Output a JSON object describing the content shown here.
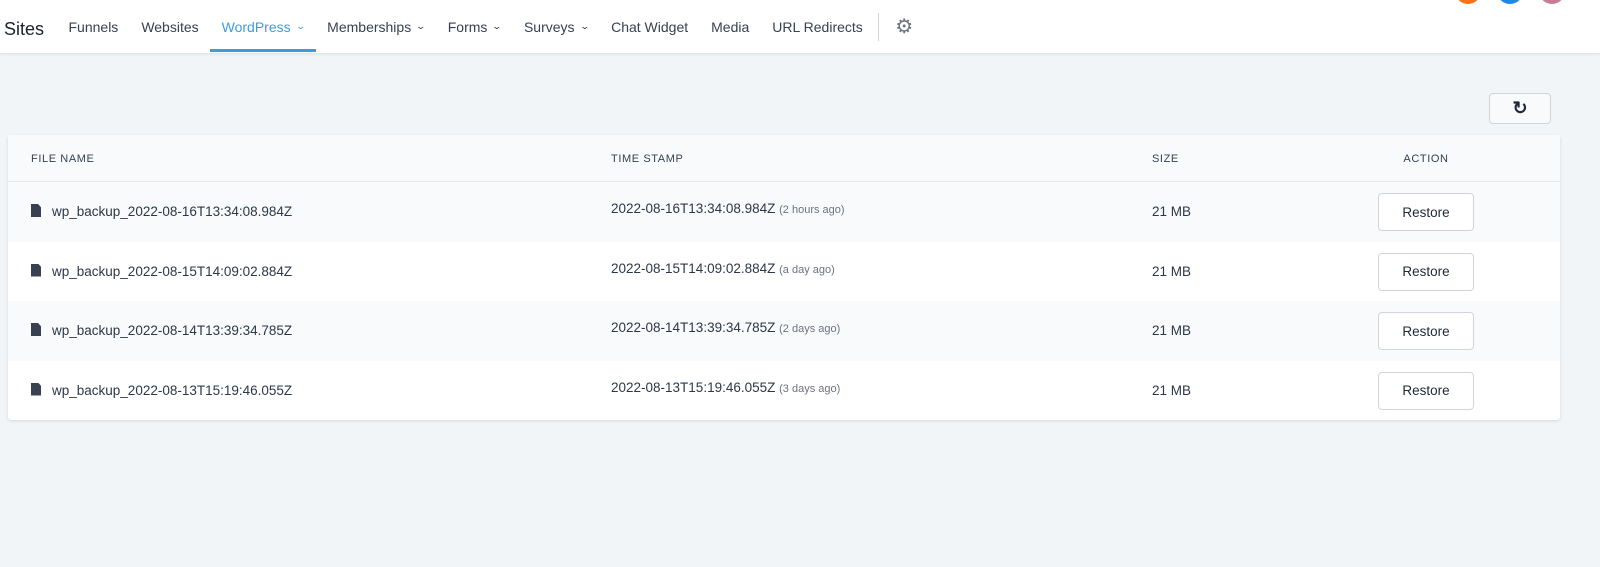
{
  "header": {
    "brand": "Sites",
    "nav": [
      {
        "label": "Funnels",
        "dropdown": false
      },
      {
        "label": "Websites",
        "dropdown": false
      },
      {
        "label": "WordPress",
        "dropdown": true,
        "active": true
      },
      {
        "label": "Memberships",
        "dropdown": true
      },
      {
        "label": "Forms",
        "dropdown": true
      },
      {
        "label": "Surveys",
        "dropdown": true
      },
      {
        "label": "Chat Widget",
        "dropdown": false
      },
      {
        "label": "Media",
        "dropdown": false
      },
      {
        "label": "URL Redirects",
        "dropdown": false
      }
    ],
    "accent": "#3b9ddd"
  },
  "table": {
    "columns": [
      "FILE NAME",
      "TIME STAMP",
      "SIZE",
      "ACTION"
    ],
    "rows": [
      {
        "file": "wp_backup_2022-08-16T13:34:08.984Z",
        "timestamp": "2022-08-16T13:34:08.984Z",
        "ago": "(2 hours ago)",
        "size": "21 MB",
        "action": "Restore"
      },
      {
        "file": "wp_backup_2022-08-15T14:09:02.884Z",
        "timestamp": "2022-08-15T14:09:02.884Z",
        "ago": "(a day ago)",
        "size": "21 MB",
        "action": "Restore"
      },
      {
        "file": "wp_backup_2022-08-14T13:39:34.785Z",
        "timestamp": "2022-08-14T13:39:34.785Z",
        "ago": "(2 days ago)",
        "size": "21 MB",
        "action": "Restore"
      },
      {
        "file": "wp_backup_2022-08-13T15:19:46.055Z",
        "timestamp": "2022-08-13T15:19:46.055Z",
        "ago": "(3 days ago)",
        "size": "21 MB",
        "action": "Restore"
      }
    ]
  }
}
